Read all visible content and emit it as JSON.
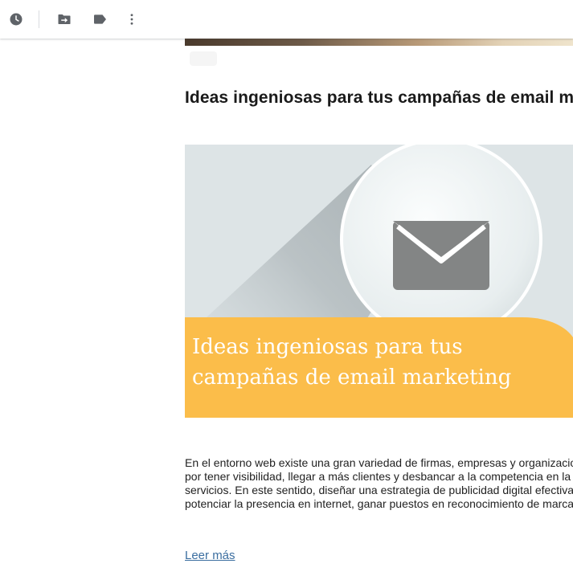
{
  "toolbar": {
    "icons": [
      "clock-icon",
      "move-to-icon",
      "label-icon",
      "more-vert-icon"
    ],
    "icon_color": "#5f6368"
  },
  "email": {
    "post_title": "Ideas ingeniosas para tus campañas de email marketing",
    "banner": {
      "line1": "Ideas ingeniosas para tus",
      "line2": "campañas de email marketing",
      "bg_color": "#dde4e6",
      "accent_color": "#fbbd4a",
      "envelope_color": "#838585"
    },
    "excerpt_lines": [
      "En el entorno web existe una gran variedad de firmas, empresas y organizaciones que compiten entre sí",
      "por tener visibilidad, llegar a más clientes y desbancar a la competencia en la venta de sus productos y",
      "servicios. En este sentido, diseñar una estrategia de publicidad digital efectiva se vuelve esencial para",
      "potenciar la presencia en internet, ganar puestos en reconocimiento de marca y aumentar las ventas."
    ],
    "read_more": "Leer más",
    "link_color": "#3b6ea0"
  }
}
